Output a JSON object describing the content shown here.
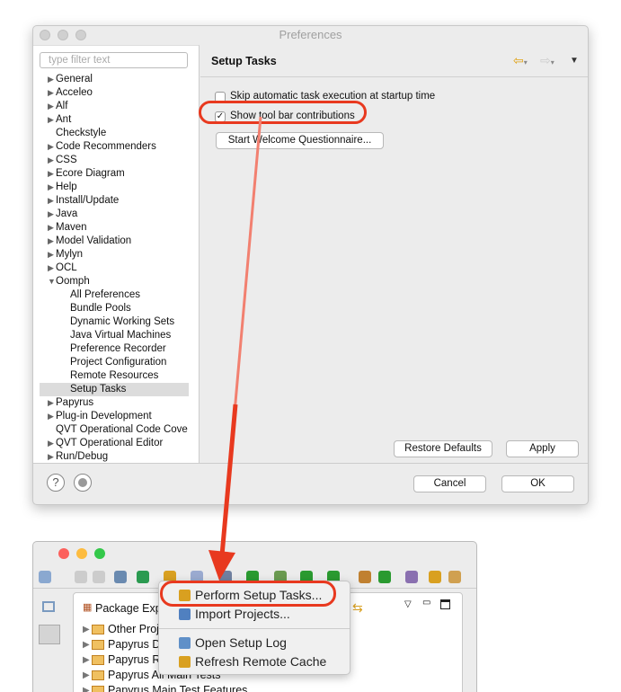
{
  "preferences": {
    "title": "Preferences",
    "filter_placeholder": "type filter text",
    "tree": [
      {
        "label": "General",
        "arrow": "right"
      },
      {
        "label": "Acceleo",
        "arrow": "right"
      },
      {
        "label": "Alf",
        "arrow": "right"
      },
      {
        "label": "Ant",
        "arrow": "right"
      },
      {
        "label": "Checkstyle",
        "arrow": ""
      },
      {
        "label": "Code Recommenders",
        "arrow": "right"
      },
      {
        "label": "CSS",
        "arrow": "right"
      },
      {
        "label": "Ecore Diagram",
        "arrow": "right"
      },
      {
        "label": "Help",
        "arrow": "right"
      },
      {
        "label": "Install/Update",
        "arrow": "right"
      },
      {
        "label": "Java",
        "arrow": "right"
      },
      {
        "label": "Maven",
        "arrow": "right"
      },
      {
        "label": "Model Validation",
        "arrow": "right"
      },
      {
        "label": "Mylyn",
        "arrow": "right"
      },
      {
        "label": "OCL",
        "arrow": "right"
      },
      {
        "label": "Oomph",
        "arrow": "down"
      },
      {
        "label": "All Preferences",
        "child": true
      },
      {
        "label": "Bundle Pools",
        "child": true
      },
      {
        "label": "Dynamic Working Sets",
        "child": true
      },
      {
        "label": "Java Virtual Machines",
        "child": true
      },
      {
        "label": "Preference Recorder",
        "child": true
      },
      {
        "label": "Project Configuration",
        "child": true
      },
      {
        "label": "Remote Resources",
        "child": true
      },
      {
        "label": "Setup Tasks",
        "child": true,
        "selected": true
      },
      {
        "label": "Papyrus",
        "arrow": "right"
      },
      {
        "label": "Plug-in Development",
        "arrow": "right"
      },
      {
        "label": "QVT Operational Code Cove",
        "arrow": ""
      },
      {
        "label": "QVT Operational Editor",
        "arrow": "right"
      },
      {
        "label": "Run/Debug",
        "arrow": "right"
      }
    ],
    "page_title": "Setup Tasks",
    "skip_label": "Skip automatic task execution at startup time",
    "skip_checked": false,
    "show_label": "Show tool bar contributions",
    "show_checked": true,
    "questionnaire_button": "Start Welcome Questionnaire...",
    "restore_button": "Restore Defaults",
    "apply_button": "Apply",
    "cancel_button": "Cancel",
    "ok_button": "OK",
    "help_glyph": "?"
  },
  "eclipse": {
    "view_title": "Package Explorer",
    "projects": [
      "Other Projects",
      "Papyrus Developer",
      "Papyrus Releng",
      "Papyrus All Main Tests",
      "Papyrus Main Test Features"
    ],
    "menu": [
      {
        "label": "Perform Setup Tasks...",
        "icon": "perform-setup-icon"
      },
      {
        "label": "Import Projects...",
        "icon": "import-projects-icon"
      },
      {
        "label": "Open Setup Log",
        "icon": "setup-log-icon"
      },
      {
        "label": "Refresh Remote Cache",
        "icon": "refresh-icon"
      }
    ]
  },
  "colors": {
    "highlight": "#e8391f",
    "selection": "#dcdcdc"
  }
}
